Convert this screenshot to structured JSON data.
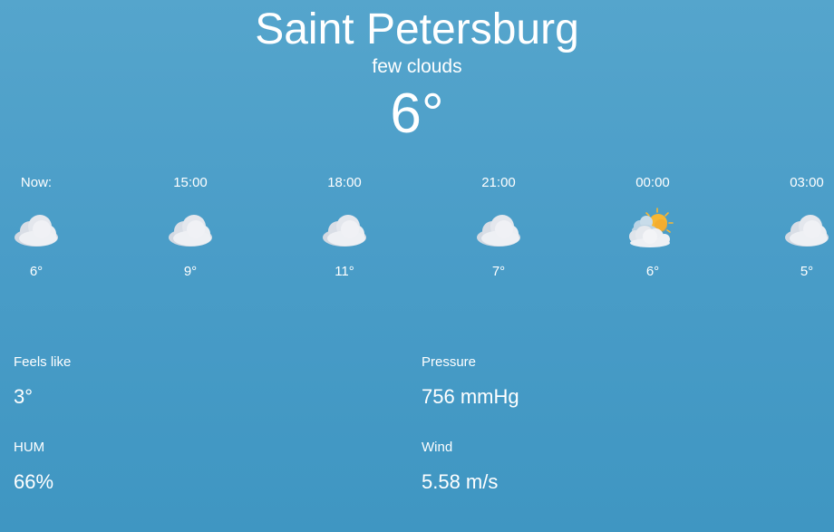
{
  "city": "Saint Petersburg",
  "description": "few clouds",
  "current_temp": "6°",
  "forecast": [
    {
      "time": "Now:",
      "icon": "cloud-icon",
      "temp": "6°"
    },
    {
      "time": "15:00",
      "icon": "cloud-icon",
      "temp": "9°"
    },
    {
      "time": "18:00",
      "icon": "cloud-icon",
      "temp": "11°"
    },
    {
      "time": "21:00",
      "icon": "cloud-icon",
      "temp": "7°"
    },
    {
      "time": "00:00",
      "icon": "partly-cloudy-sun-icon",
      "temp": "6°"
    },
    {
      "time": "03:00",
      "icon": "cloud-icon",
      "temp": "5°"
    }
  ],
  "details": {
    "feels_like": {
      "label": "Feels like",
      "value": "3°"
    },
    "pressure": {
      "label": "Pressure",
      "value": "756 mmHg"
    },
    "humidity": {
      "label": "HUM",
      "value": "66%"
    },
    "wind": {
      "label": "Wind",
      "value": "5.58 m/s"
    }
  },
  "colors": {
    "background_top": "#55a5cc",
    "background_bottom": "#3f96c2",
    "text": "#ffffff",
    "cloud": "#eef0f4",
    "cloud_shadow": "#c9d0da",
    "sun": "#f7b733"
  }
}
